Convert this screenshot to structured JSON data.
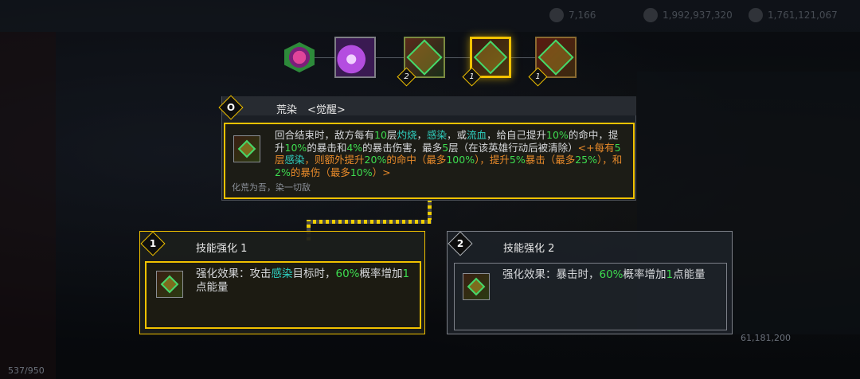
{
  "top_stats": [
    "7,166",
    "1,992,937,320",
    "1,761,121,067"
  ],
  "footer_left": "537/950",
  "footer_right": "61,181,200",
  "skill_tree": {
    "node_levels": [
      "2",
      "1",
      "1"
    ]
  },
  "main_skill": {
    "badge": "O",
    "title": "荒染　<觉醒>",
    "desc_segments": [
      {
        "text": "回合结束时，敌方每有",
        "c": ""
      },
      {
        "text": "10",
        "c": "g"
      },
      {
        "text": "层",
        "c": ""
      },
      {
        "text": "灼烧",
        "c": "t"
      },
      {
        "text": "，",
        "c": ""
      },
      {
        "text": "感染",
        "c": "t"
      },
      {
        "text": "，或",
        "c": ""
      },
      {
        "text": "流血",
        "c": "t"
      },
      {
        "text": "，给自己提升",
        "c": ""
      },
      {
        "text": "10%",
        "c": "g"
      },
      {
        "text": "的命中，提升",
        "c": ""
      },
      {
        "text": "10%",
        "c": "g"
      },
      {
        "text": "的暴击和",
        "c": ""
      },
      {
        "text": "4%",
        "c": "g"
      },
      {
        "text": "的暴击伤害，最多",
        "c": ""
      },
      {
        "text": "5",
        "c": "g"
      },
      {
        "text": "层（在该英雄行动后被清除）",
        "c": ""
      },
      {
        "text": "<+每有",
        "c": "o"
      },
      {
        "text": "5",
        "c": "g"
      },
      {
        "text": "层",
        "c": "o"
      },
      {
        "text": "感染",
        "c": "t"
      },
      {
        "text": "，则额外提升",
        "c": "o"
      },
      {
        "text": "20%",
        "c": "g"
      },
      {
        "text": "的命中（最多",
        "c": "o"
      },
      {
        "text": "100%",
        "c": "g"
      },
      {
        "text": "），提升",
        "c": "o"
      },
      {
        "text": "5%",
        "c": "g"
      },
      {
        "text": "暴击（最多",
        "c": "o"
      },
      {
        "text": "25%",
        "c": "g"
      },
      {
        "text": "），和",
        "c": "o"
      },
      {
        "text": "2%",
        "c": "g"
      },
      {
        "text": "的暴伤（最多",
        "c": "o"
      },
      {
        "text": "10%",
        "c": "g"
      },
      {
        "text": "）>",
        "c": "o"
      }
    ],
    "flavor": "化荒为吾，染一切敌"
  },
  "enhance1": {
    "badge": "1",
    "title": "技能强化 1",
    "desc_segments": [
      {
        "text": "强化效果：攻击",
        "c": ""
      },
      {
        "text": "感染",
        "c": "t"
      },
      {
        "text": "目标时，",
        "c": ""
      },
      {
        "text": "60%",
        "c": "g"
      },
      {
        "text": "概率增加",
        "c": ""
      },
      {
        "text": "1",
        "c": "g"
      },
      {
        "text": "点能量",
        "c": ""
      }
    ]
  },
  "enhance2": {
    "badge": "2",
    "title": "技能强化 2",
    "desc_segments": [
      {
        "text": "强化效果：暴击时，",
        "c": ""
      },
      {
        "text": "60%",
        "c": "g"
      },
      {
        "text": "概率增加",
        "c": ""
      },
      {
        "text": "1",
        "c": "g"
      },
      {
        "text": "点能量",
        "c": ""
      }
    ]
  }
}
